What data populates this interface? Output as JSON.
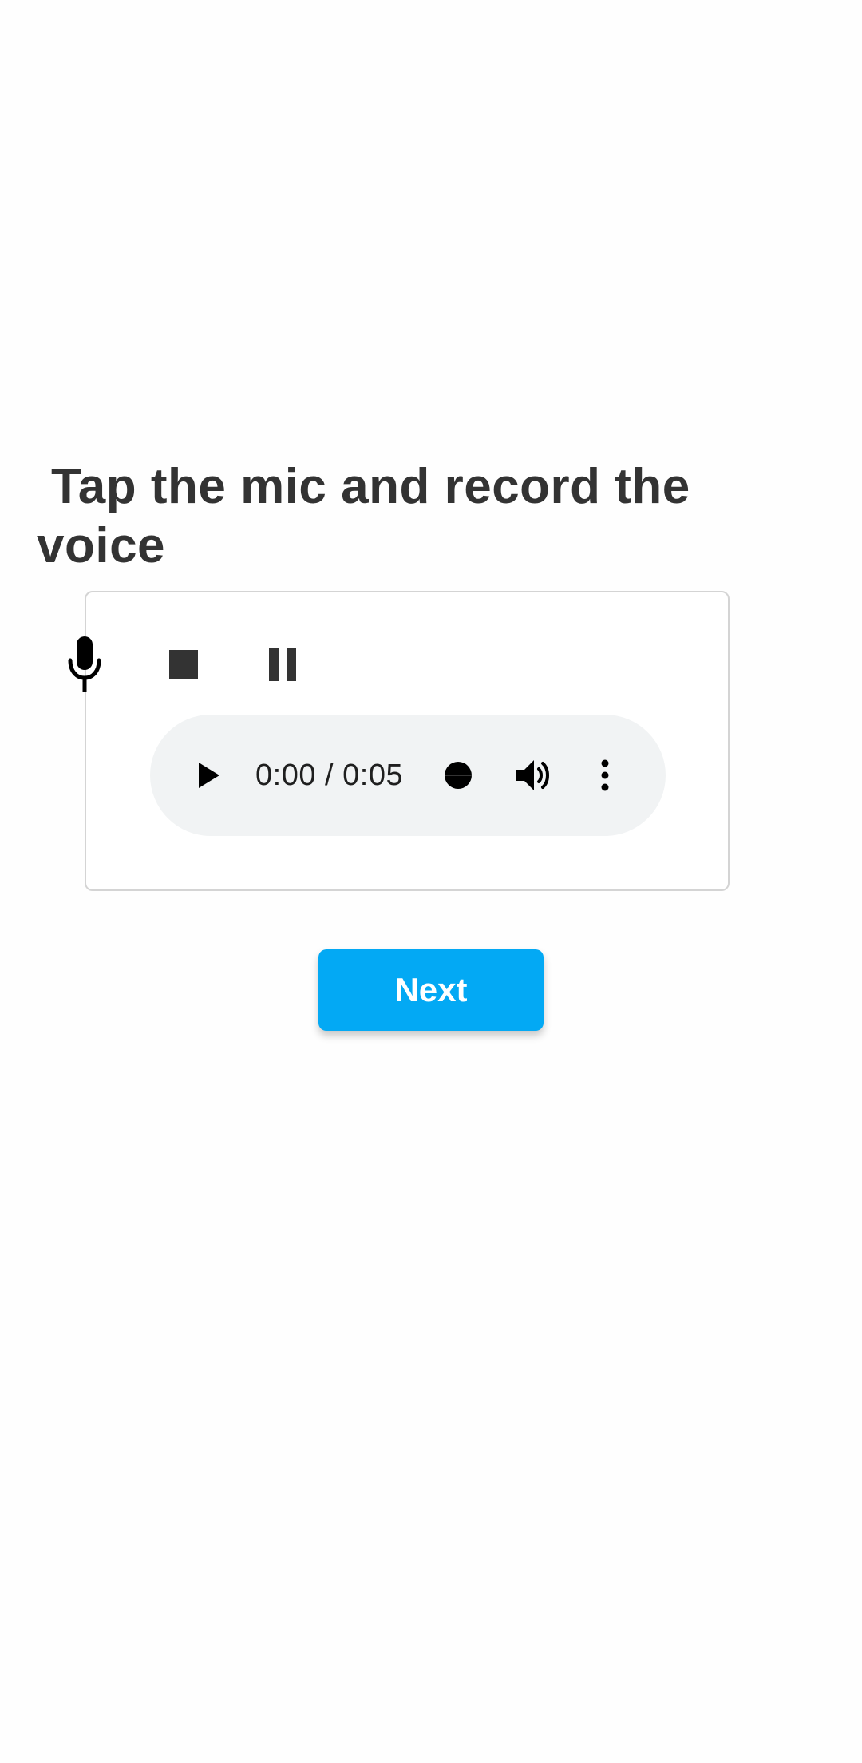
{
  "prompt": {
    "title": "Tap the mic and record the voice"
  },
  "recorder": {
    "icons": {
      "mic": "mic-icon",
      "stop": "stop-icon",
      "pause": "pause-icon"
    }
  },
  "player": {
    "time_display": "0:00 / 0:05",
    "icons": {
      "play": "play-icon",
      "scrubber": "scrubber-thumb-icon",
      "volume": "volume-icon",
      "menu": "more-vert-icon"
    }
  },
  "actions": {
    "next_label": "Next"
  },
  "colors": {
    "primary_button": "#03a9f4",
    "title_text": "#333333",
    "player_background": "#f1f3f4"
  }
}
